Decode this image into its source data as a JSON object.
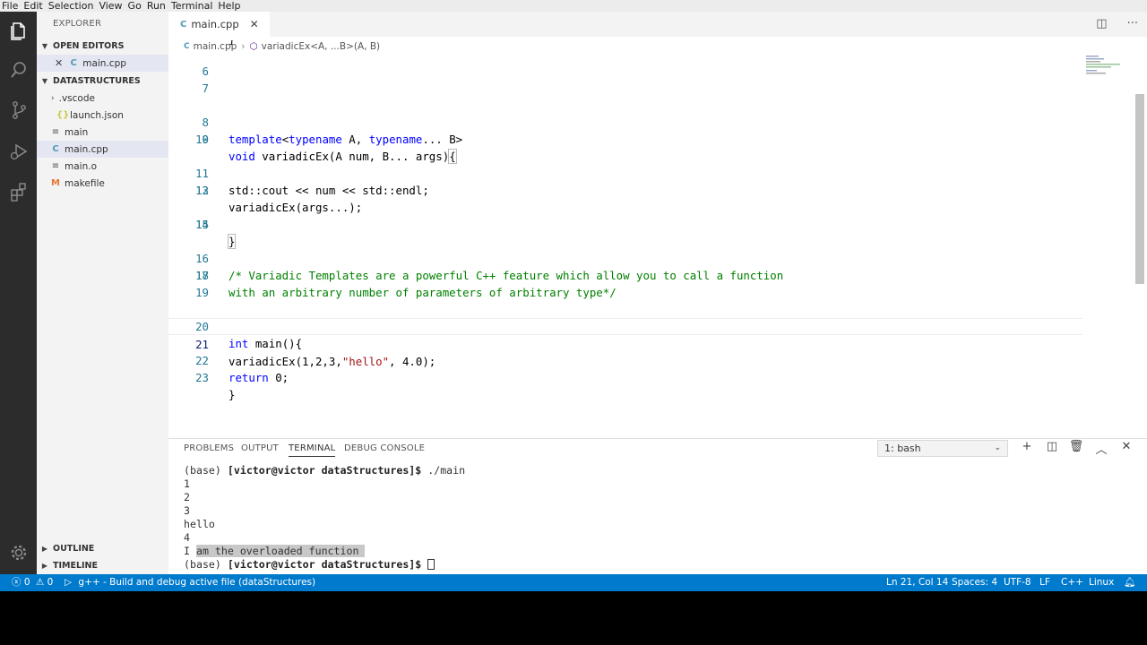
{
  "menu": [
    "File",
    "Edit",
    "Selection",
    "View",
    "Go",
    "Run",
    "Terminal",
    "Help"
  ],
  "activity_icons": [
    "files-icon",
    "search-icon",
    "source-control-icon",
    "run-debug-icon",
    "extensions-icon",
    "settings-gear-icon"
  ],
  "sidebar": {
    "title": "EXPLORER",
    "open_editors": "OPEN EDITORS",
    "open_file": "main.cpp",
    "project": "DATASTRUCTURES",
    "files": [
      {
        "name": ".vscode",
        "kind": "folder"
      },
      {
        "name": "launch.json",
        "kind": "json"
      },
      {
        "name": "main",
        "kind": "file"
      },
      {
        "name": "main.cpp",
        "kind": "cpp"
      },
      {
        "name": "main.o",
        "kind": "file"
      },
      {
        "name": "makefile",
        "kind": "make"
      }
    ],
    "outline": "OUTLINE",
    "timeline": "TIMELINE"
  },
  "editor": {
    "tab_label": "main.cpp",
    "breadcrumb_file": "main.cpp",
    "breadcrumb_symbol": "variadicEx<A, ...B>(A, B)",
    "lines": [
      {
        "n": "6"
      },
      {
        "n": "7"
      },
      {
        "n": "8"
      },
      {
        "n": "9"
      },
      {
        "n": "10"
      },
      {
        "n": "11"
      },
      {
        "n": "12"
      },
      {
        "n": "13"
      },
      {
        "n": "14"
      },
      {
        "n": "15"
      },
      {
        "n": "16"
      },
      {
        "n": "17"
      },
      {
        "n": "18"
      },
      {
        "n": "19"
      },
      {
        "n": "20"
      },
      {
        "n": "21"
      },
      {
        "n": "22"
      },
      {
        "n": "23"
      }
    ],
    "code": {
      "l8_kw1": "template",
      "l8_lt": "<",
      "l8_kw2": "typename",
      "l8_a": " A, ",
      "l8_kw3": "typename",
      "l8_rest": "... B>",
      "l9_kw": "void",
      "l9_rest": " variadicEx(A num, B... args)",
      "l9_brace": "{",
      "l11": "std::cout << num << std::endl;",
      "l12": "variadicEx(args...);",
      "l14": "}",
      "l16": "/* Variadic Templates are a powerful C++ feature which allow you to call a function",
      "l17": "with an arbitrary number of parameters of arbitrary type*/",
      "l20_kw": "int",
      "l20_rest": " main(){",
      "l21_a": "variadicEx(1,2,3,",
      "l21_str": "\"hello\"",
      "l21_b": ", 4.0);",
      "l22_kw": "return",
      "l22_rest": " 0;",
      "l23": "}"
    }
  },
  "panel": {
    "tabs": [
      "PROBLEMS",
      "OUTPUT",
      "TERMINAL",
      "DEBUG CONSOLE"
    ],
    "active_tab": "TERMINAL",
    "terminal_select": "1: bash",
    "terminal": {
      "prompt_pre": "(base) ",
      "prompt_user": "[victor@victor dataStructures]$",
      "cmd": " ./main",
      "out1": "1",
      "out2": "2",
      "out3": "3",
      "out4": "hello",
      "out5": "4",
      "out6_a": "I ",
      "out6_b": "am the overloaded function "
    }
  },
  "status": {
    "errors": "0",
    "warnings": "0",
    "task": "g++ - Build and debug active file (dataStructures)",
    "position": "Ln 21, Col 14",
    "spaces": "Spaces: 4",
    "encoding": "UTF-8",
    "eol": "LF",
    "language": "C++",
    "os": "Linux"
  },
  "colors": {
    "status_bar": "#007acc",
    "activity_bar": "#2c2c2c",
    "sidebar": "#f3f3f3"
  }
}
